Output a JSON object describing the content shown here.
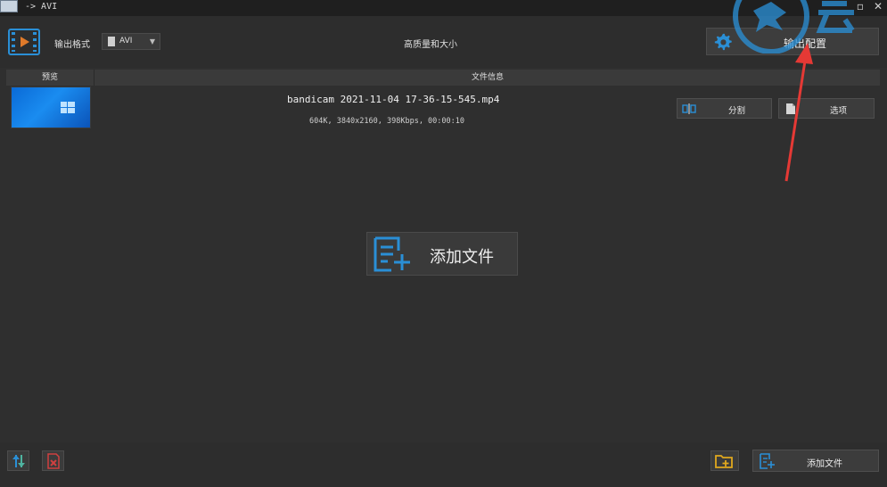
{
  "titlebar": {
    "title": "-> AVI"
  },
  "toolbar": {
    "format_label": "输出格式",
    "format_value": "AVI",
    "quality_label": "高质量和大小",
    "output_config_label": "输出配置"
  },
  "table": {
    "col_preview": "预览",
    "col_info": "文件信息"
  },
  "file": {
    "name": "bandicam 2021-11-04 17-36-15-545.mp4",
    "meta": "604K, 3840x2160, 398Kbps, 00:00:10",
    "split_label": "分割",
    "options_label": "选项"
  },
  "center": {
    "add_file_label": "添加文件"
  },
  "bottom": {
    "add_file_label": "添加文件"
  },
  "colors": {
    "accent_blue": "#2a8fd6",
    "annotation_red": "#e53935",
    "folder_yellow": "#e0a81e",
    "background": "#2f2f2f"
  }
}
